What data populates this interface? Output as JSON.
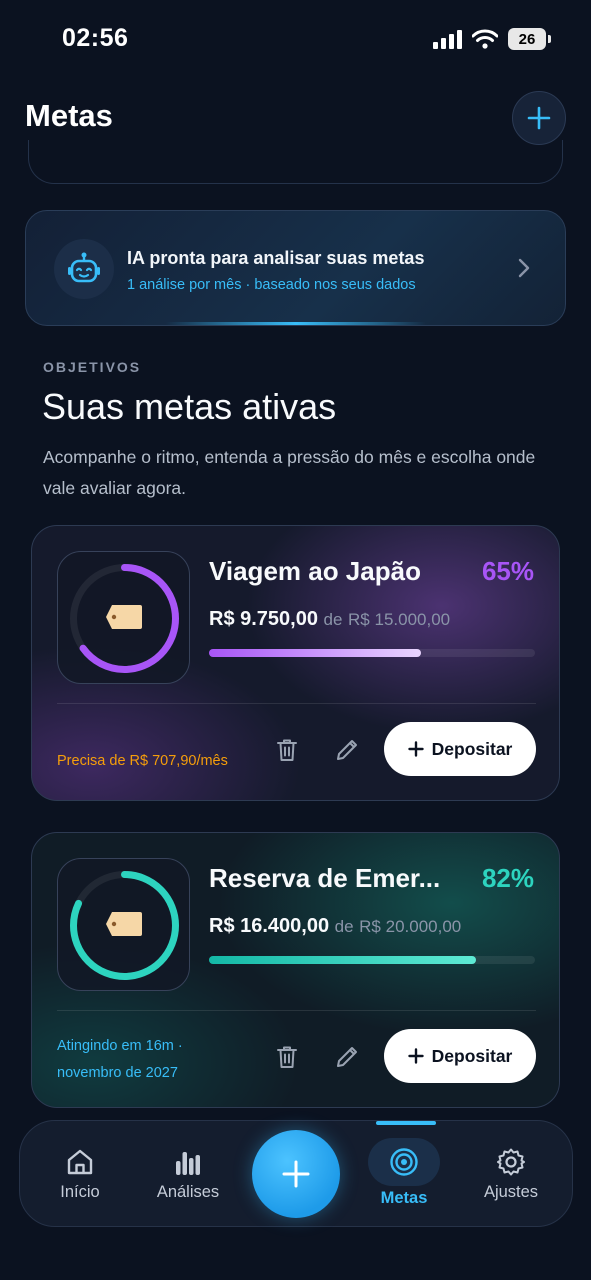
{
  "status_bar": {
    "time": "02:56",
    "battery": "26"
  },
  "header": {
    "title": "Metas"
  },
  "ai_card": {
    "title": "IA pronta para analisar suas metas",
    "subtitle": "1 análise por mês · baseado nos seus dados"
  },
  "section": {
    "kicker": "OBJETIVOS",
    "title": "Suas metas ativas",
    "description": "Acompanhe o ritmo, entenda a pressão do mês e escolha onde vale avaliar agora."
  },
  "goals": [
    {
      "name": "Viagem ao Japão",
      "percent_label": "65%",
      "progress": 0.65,
      "saved": "R$ 9.750,00",
      "of_label": "de",
      "target": "R$ 15.000,00",
      "hint_line1": "Precisa de R$ 707,90/mês",
      "hint_line2": "",
      "deposit_label": "Depositar",
      "accent": "#a855f7",
      "hint_color": "#f59e0b"
    },
    {
      "name": "Reserva de Emer...",
      "percent_label": "82%",
      "progress": 0.82,
      "saved": "R$ 16.400,00",
      "of_label": "de",
      "target": "R$ 20.000,00",
      "hint_line1": "Atingindo em 16m ·",
      "hint_line2": "novembro de 2027",
      "deposit_label": "Depositar",
      "accent": "#2dd4bf",
      "hint_color": "#38bdf8"
    }
  ],
  "bottom_nav": {
    "items": [
      {
        "label": "Início",
        "icon": "home-icon"
      },
      {
        "label": "Análises",
        "icon": "bar-chart-icon"
      },
      {
        "label": "Metas",
        "icon": "target-icon",
        "active": true
      },
      {
        "label": "Ajustes",
        "icon": "gear-icon"
      }
    ],
    "fab_icon": "plus-icon"
  },
  "colors": {
    "background": "#0b1220",
    "accent_blue": "#38bdf8"
  }
}
